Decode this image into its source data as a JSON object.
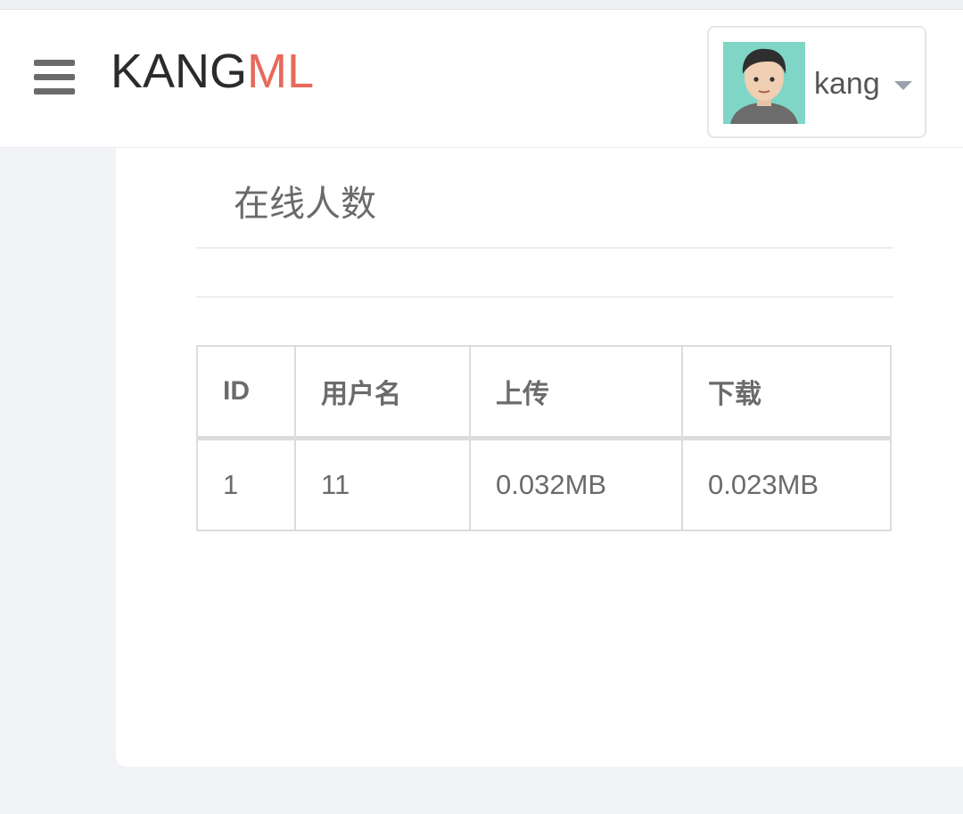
{
  "header": {
    "brand_primary": "KANG",
    "brand_accent": "ML",
    "username": "kang",
    "icons": {
      "menu": "hamburger-menu-icon",
      "caret": "caret-down-icon",
      "avatar": "user-avatar"
    }
  },
  "panel": {
    "title": "在线人数",
    "table": {
      "headers": [
        "ID",
        "用户名",
        "上传",
        "下载"
      ],
      "rows": [
        [
          "1",
          "11",
          "0.032MB",
          "0.023MB"
        ]
      ]
    }
  },
  "colors": {
    "accent": "#e8695a",
    "background": "#f1f3f6"
  }
}
